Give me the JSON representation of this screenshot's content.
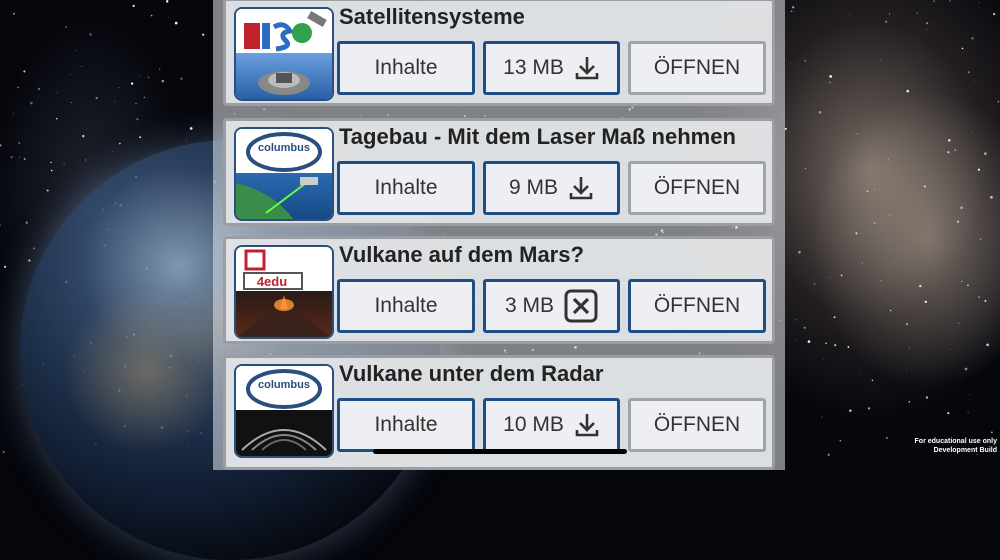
{
  "items": [
    {
      "title": "Satellitensysteme",
      "contents_label": "Inhalte",
      "size": "13 MB",
      "state_icon": "download-icon",
      "open_label": "ÖFFNEN",
      "logo": "gis-logo",
      "image": "satellite-image"
    },
    {
      "title": "Tagebau - Mit dem Laser Maß nehmen",
      "contents_label": "Inhalte",
      "size": "9 MB",
      "state_icon": "download-icon",
      "open_label": "ÖFFNEN",
      "logo": "columbus-eye-logo",
      "image": "earth-laser-image",
      "logo_text": "columbus"
    },
    {
      "title": "Vulkane auf dem Mars?",
      "contents_label": "Inhalte",
      "size": "3 MB",
      "state_icon": "cancel-icon",
      "open_label": "ÖFFNEN",
      "logo": "4edu-logo",
      "image": "volcano-image",
      "logo_text": "4edu"
    },
    {
      "title": "Vulkane unter dem Radar",
      "contents_label": "Inhalte",
      "size": "10 MB",
      "state_icon": "download-icon",
      "open_label": "ÖFFNEN",
      "logo": "columbus-eye-logo",
      "image": "radar-image",
      "logo_text": "columbus"
    }
  ],
  "footer": {
    "line1": "For educational use only",
    "line2": "Development Build"
  },
  "colors": {
    "accent": "#1f4e86",
    "card": "#e2e4e7",
    "muted_border": "#a0a3a8"
  }
}
